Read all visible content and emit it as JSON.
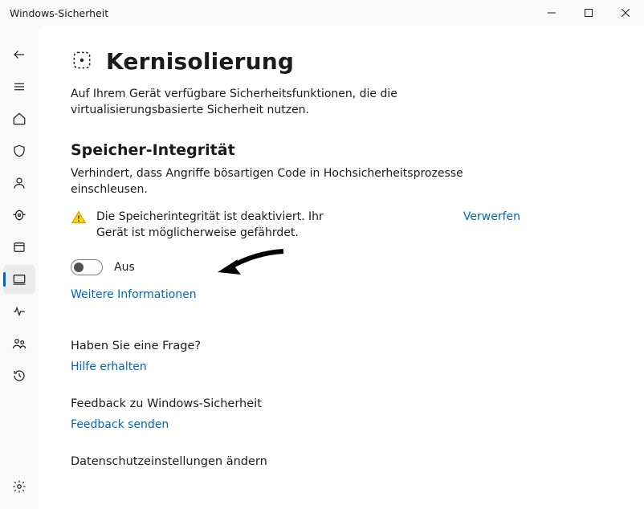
{
  "window": {
    "title": "Windows-Sicherheit"
  },
  "page": {
    "title": "Kernisolierung",
    "subtitle": "Auf Ihrem Gerät verfügbare Sicherheitsfunktionen, die die virtualisierungsbasierte Sicherheit nutzen."
  },
  "memory_integrity": {
    "heading": "Speicher-Integrität",
    "description": "Verhindert, dass Angriffe bösartigen Code in Hochsicherheitsprozesse einschleusen.",
    "warning_text": "Die Speicherintegrität ist deaktiviert. Ihr Gerät ist möglicherweise gefährdet.",
    "dismiss_label": "Verwerfen",
    "toggle_state_label": "Aus",
    "more_info_label": "Weitere Informationen"
  },
  "help": {
    "heading": "Haben Sie eine Frage?",
    "link": "Hilfe erhalten"
  },
  "feedback": {
    "heading": "Feedback zu Windows-Sicherheit",
    "link": "Feedback senden"
  },
  "privacy": {
    "heading": "Datenschutzeinstellungen ändern"
  }
}
